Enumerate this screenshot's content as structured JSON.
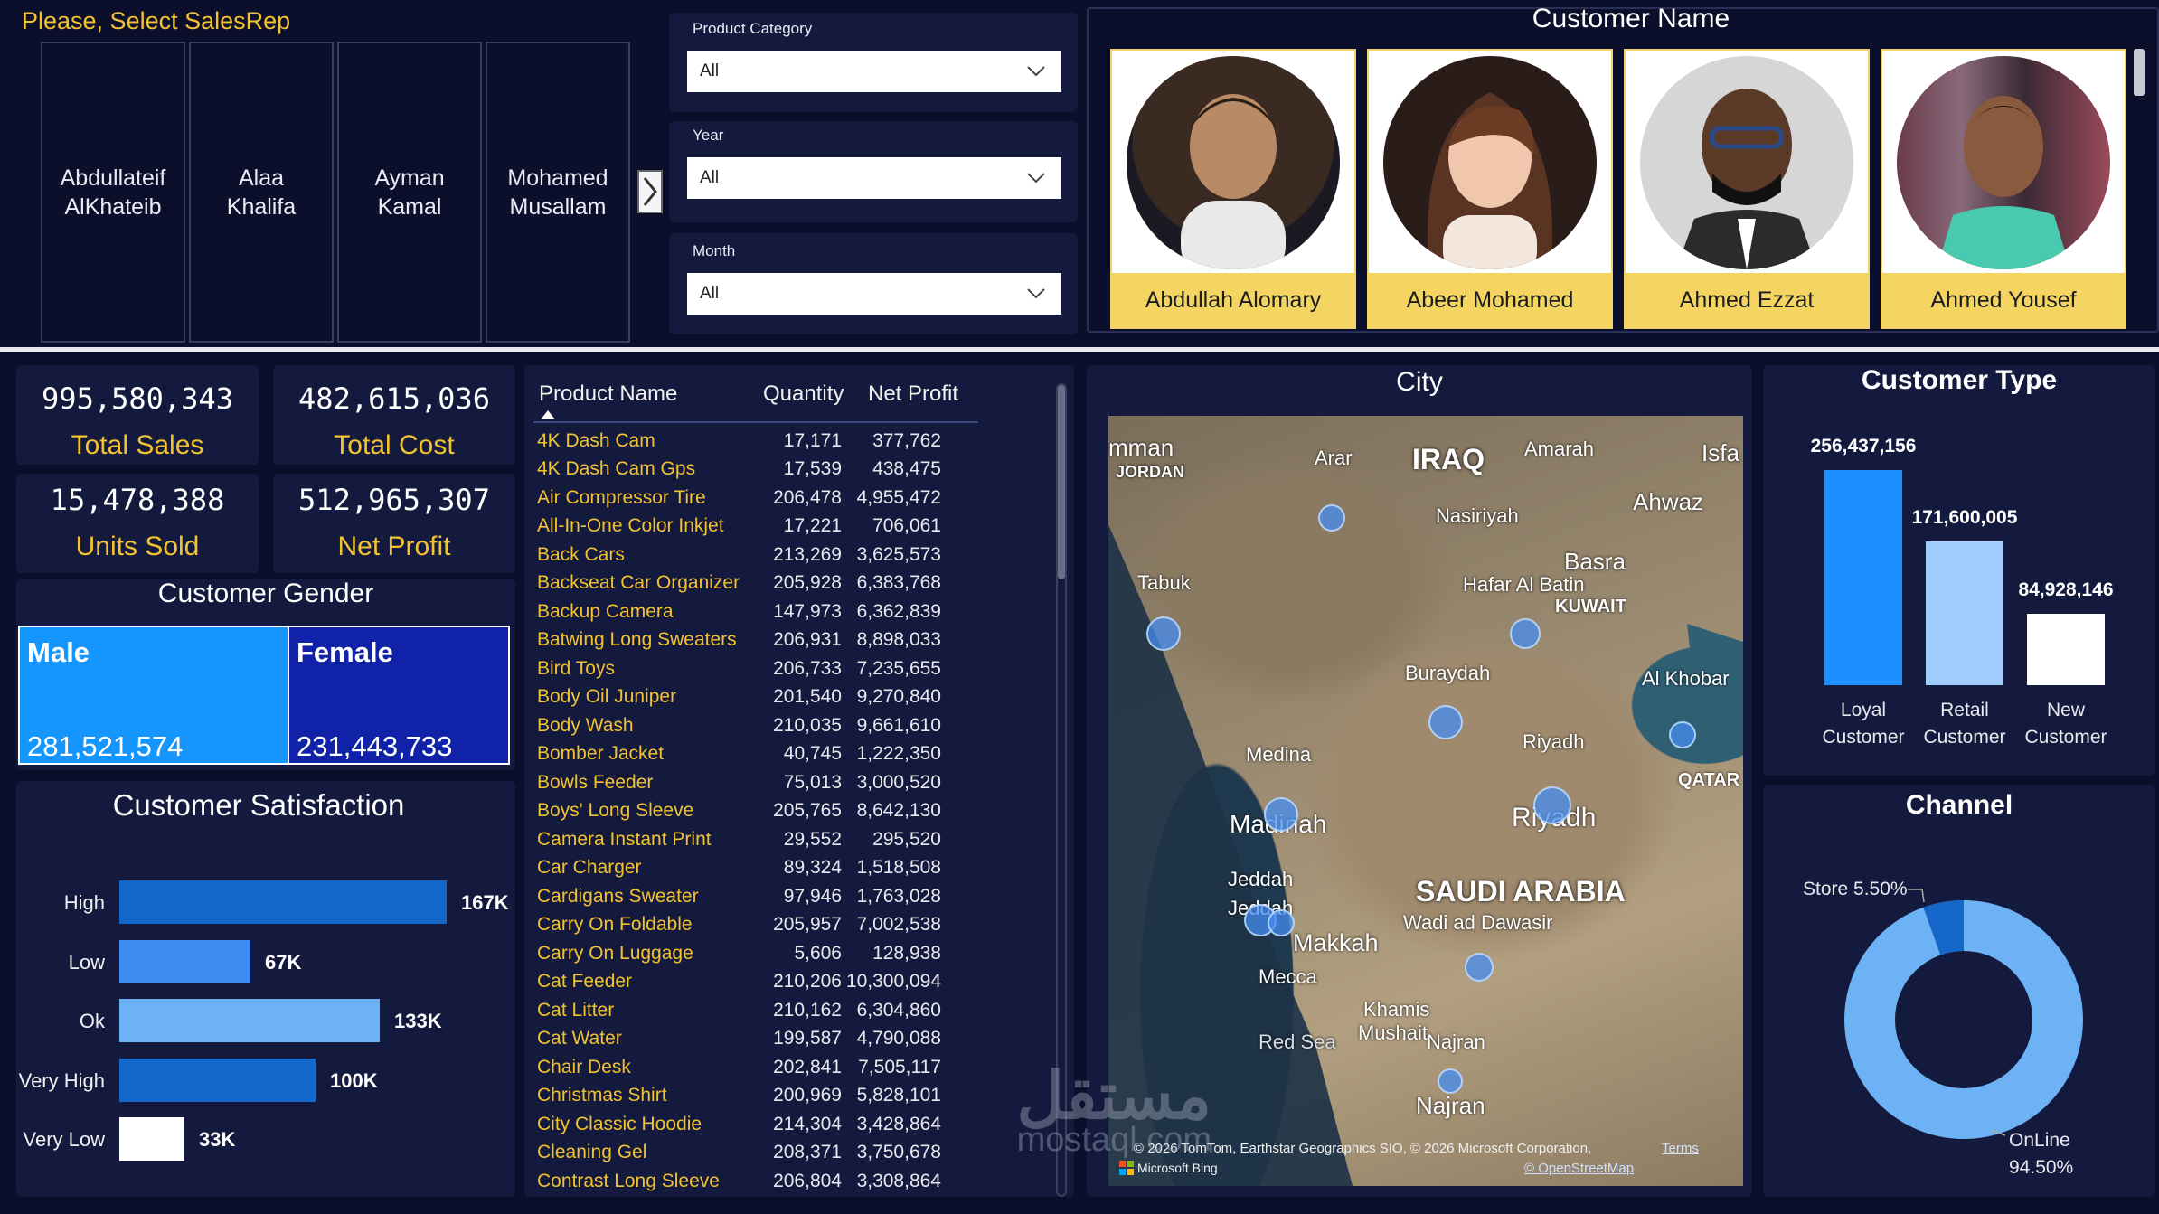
{
  "salesrep_slicer": {
    "title": "Please, Select SalesRep",
    "reps": [
      "Abdullateif AlKhateib",
      "Alaa Khalifa",
      "Ayman Kamal",
      "Mohamed Musallam"
    ]
  },
  "filters": [
    {
      "label": "Product Category",
      "value": "All"
    },
    {
      "label": "Year",
      "value": "All"
    },
    {
      "label": "Month",
      "value": "All"
    }
  ],
  "customers": {
    "title": "Customer Name",
    "cards": [
      {
        "name": "Abdullah Alomary"
      },
      {
        "name": "Abeer Mohamed"
      },
      {
        "name": "Ahmed Ezzat"
      },
      {
        "name": "Ahmed Yousef"
      }
    ]
  },
  "kpis": [
    {
      "value": "995,580,343",
      "label": "Total Sales"
    },
    {
      "value": "482,615,036",
      "label": "Total Cost"
    },
    {
      "value": "15,478,388",
      "label": "Units Sold"
    },
    {
      "value": "512,965,307",
      "label": "Net Profit"
    }
  ],
  "gender": {
    "title": "Customer Gender",
    "male_label": "Male",
    "male_value": "281,521,574",
    "female_label": "Female",
    "female_value": "231,443,733",
    "male_share": 0.549
  },
  "satisfaction": {
    "title": "Customer Satisfaction",
    "items": [
      {
        "label": "High",
        "value_label": "167K",
        "value": 167,
        "color": "#1466c8"
      },
      {
        "label": "Low",
        "value_label": "67K",
        "value": 67,
        "color": "#3d8ef0"
      },
      {
        "label": "Ok",
        "value_label": "133K",
        "value": 133,
        "color": "#6db2f5"
      },
      {
        "label": "Very High",
        "value_label": "100K",
        "value": 100,
        "color": "#1466c8"
      },
      {
        "label": "Very Low",
        "value_label": "33K",
        "value": 33,
        "color": "#ffffff"
      }
    ]
  },
  "products": {
    "headers": {
      "name": "Product Name",
      "qty": "Quantity",
      "profit": "Net Profit"
    },
    "rows": [
      [
        "4K Dash Cam",
        "17,171",
        "377,762"
      ],
      [
        "4K Dash Cam Gps",
        "17,539",
        "438,475"
      ],
      [
        "Air Compressor Tire",
        "206,478",
        "4,955,472"
      ],
      [
        "All-In-One Color Inkjet",
        "17,221",
        "706,061"
      ],
      [
        "Back Cars",
        "213,269",
        "3,625,573"
      ],
      [
        "Backseat Car Organizer",
        "205,928",
        "6,383,768"
      ],
      [
        "Backup Camera",
        "147,973",
        "6,362,839"
      ],
      [
        "Batwing Long Sweaters",
        "206,931",
        "8,898,033"
      ],
      [
        "Bird Toys",
        "206,733",
        "7,235,655"
      ],
      [
        "Body Oil Juniper",
        "201,540",
        "9,270,840"
      ],
      [
        "Body Wash",
        "210,035",
        "9,661,610"
      ],
      [
        "Bomber Jacket",
        "40,745",
        "1,222,350"
      ],
      [
        "Bowls Feeder",
        "75,013",
        "3,000,520"
      ],
      [
        "Boys' Long Sleeve",
        "205,765",
        "8,642,130"
      ],
      [
        "Camera Instant Print",
        "29,552",
        "295,520"
      ],
      [
        "Car Charger",
        "89,324",
        "1,518,508"
      ],
      [
        "Cardigans Sweater",
        "97,946",
        "1,763,028"
      ],
      [
        "Carry On Foldable",
        "205,957",
        "7,002,538"
      ],
      [
        "Carry On Luggage",
        "5,606",
        "128,938"
      ],
      [
        "Cat Feeder",
        "210,206",
        "10,300,094"
      ],
      [
        "Cat Litter",
        "210,162",
        "6,304,860"
      ],
      [
        "Cat Water",
        "199,587",
        "4,790,088"
      ],
      [
        "Chair Desk",
        "202,841",
        "7,505,117"
      ],
      [
        "Christmas Shirt",
        "200,969",
        "5,828,101"
      ],
      [
        "City Classic Hoodie",
        "214,304",
        "3,428,864"
      ],
      [
        "Cleaning Gel",
        "208,371",
        "3,750,678"
      ],
      [
        "Contrast Long Sleeve",
        "206,804",
        "3,308,864"
      ]
    ]
  },
  "map": {
    "title": "City",
    "country": "SAUDI ARABIA",
    "labels": {
      "amman": "mman",
      "jordan": "JORDAN",
      "iraq": "IRAQ",
      "amarah": "Amarah",
      "isfa": "Isfa",
      "arar": "Arar",
      "nasiriyah": "Nasiriyah",
      "ahwaz": "Ahwaz",
      "basra": "Basra",
      "tabuk": "Tabuk",
      "hafar": "Hafar Al Batin",
      "kuwait": "KUWAIT",
      "buraydah": "Buraydah",
      "alkhobar": "Al Khobar",
      "medina": "Medina",
      "riyadh_a": "Riyadh",
      "madinah": "Madinah",
      "riyadh_b": "Riyadh",
      "qatar": "QATAR",
      "jeddah_a": "Jeddah",
      "jeddah_b": "Jeddah",
      "makkah": "Makkah",
      "mecca": "Mecca",
      "wadi": "Wadi ad Dawasir",
      "khamis": "Khamis",
      "mushait": "Mushait",
      "najran_a": "Najran",
      "najran_b": "Najran",
      "redsea": "Red Sea"
    },
    "copyright": "© 2026 TomTom, Earthstar Geographics SIO, © 2026 Microsoft Corporation,",
    "terms": "Terms",
    "osm": "© OpenStreetMap",
    "bing": "Microsoft Bing"
  },
  "customer_type": {
    "title": "Customer Type",
    "items": [
      {
        "label1": "Loyal",
        "label2": "Customer",
        "value_label": "256,437,156",
        "value": 256437156,
        "color": "#1e8fff"
      },
      {
        "label1": "Retail",
        "label2": "Customer",
        "value_label": "171,600,005",
        "value": 171600005,
        "color": "#9fcdfb"
      },
      {
        "label1": "New",
        "label2": "Customer",
        "value_label": "84,928,146",
        "value": 84928146,
        "color": "#ffffff"
      }
    ]
  },
  "channel": {
    "title": "Channel",
    "store_label": "Store 5.50%",
    "online_label": "OnLine",
    "online_pct": "94.50%",
    "store_share": 0.055,
    "online_color": "#6db2f5",
    "store_color": "#1466c8"
  },
  "watermark": {
    "arabic": "مستقل",
    "latin": "mostaql.com"
  }
}
